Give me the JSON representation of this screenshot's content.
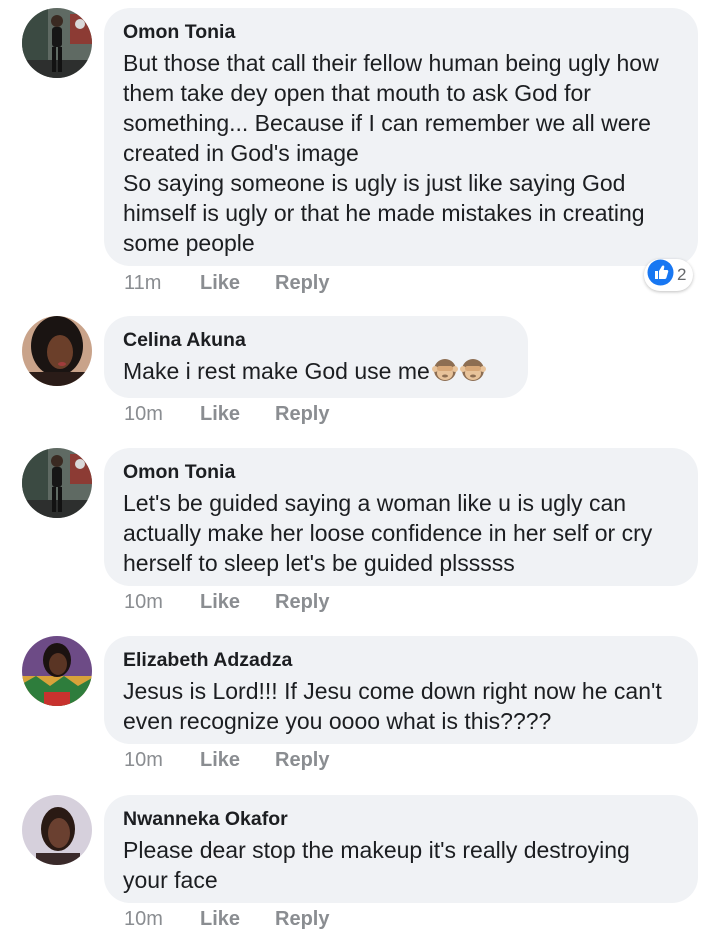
{
  "colors": {
    "bubble": "#f0f2f5",
    "meta_text": "#8a8d91",
    "like_blue": "#1877f2"
  },
  "comments": [
    {
      "author": "Omon Tonia",
      "text": "But those that call their fellow human being ugly how them take dey open that mouth to ask God for something... Because if I can remember we all were created in God's image\nSo saying someone is ugly is just like saying God himself is ugly or that he made mistakes in creating some people",
      "time": "11m",
      "like": "Like",
      "reply": "Reply",
      "reactions": {
        "icon": "like-reaction-icon",
        "count": "2"
      }
    },
    {
      "author": "Celina Akuna",
      "text": "Make i rest make God use me",
      "emoji": [
        "see-no-evil-monkey-icon",
        "see-no-evil-monkey-icon"
      ],
      "time": "10m",
      "like": "Like",
      "reply": "Reply"
    },
    {
      "author": "Omon Tonia",
      "text": "Let's be guided saying a woman like u is ugly can actually make her loose confidence in her self or cry herself to sleep let's be guided plsssss",
      "time": "10m",
      "like": "Like",
      "reply": "Reply"
    },
    {
      "author": "Elizabeth Adzadza",
      "text": "Jesus is Lord!!! If Jesu come down right now he can't even recognize you oooo what is this????",
      "time": "10m",
      "like": "Like",
      "reply": "Reply"
    },
    {
      "author": "Nwanneka Okafor",
      "text": "Please dear stop the makeup it's really destroying your face",
      "time": "10m",
      "like": "Like",
      "reply": "Reply"
    }
  ]
}
